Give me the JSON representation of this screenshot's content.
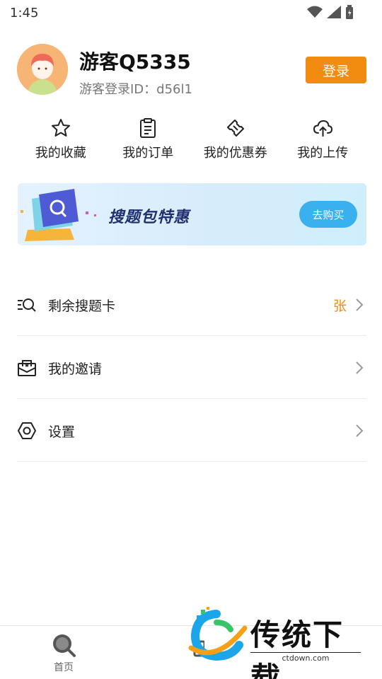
{
  "status_bar": {
    "time": "1:45",
    "icons": [
      "wifi-icon",
      "signal-icon",
      "battery-icon"
    ]
  },
  "profile": {
    "username": "游客Q5335",
    "guest_id": "游客登录ID：d56l1",
    "login_label": "登录",
    "avatar": "avatar-girl"
  },
  "shortcuts": [
    {
      "label": "我的收藏",
      "icon": "star-icon"
    },
    {
      "label": "我的订单",
      "icon": "clipboard-icon"
    },
    {
      "label": "我的优惠券",
      "icon": "ticket-icon"
    },
    {
      "label": "我的上传",
      "icon": "cloud-upload-icon"
    }
  ],
  "banner": {
    "title": "搜题包特惠",
    "button": "去购买"
  },
  "menu": [
    {
      "label": "剩余搜题卡",
      "value": "张",
      "icon": "search-list-icon"
    },
    {
      "label": "我的邀请",
      "value": "",
      "icon": "mail-invite-icon"
    },
    {
      "label": "设置",
      "value": "",
      "icon": "settings-icon"
    }
  ],
  "bottom_nav": [
    {
      "label": "首页",
      "icon": "search-icon"
    }
  ],
  "watermark": {
    "text": "传统下载",
    "url": "ctdown.com"
  },
  "colors": {
    "accent": "#f28c11",
    "banner_button": "#3ab0ee"
  }
}
